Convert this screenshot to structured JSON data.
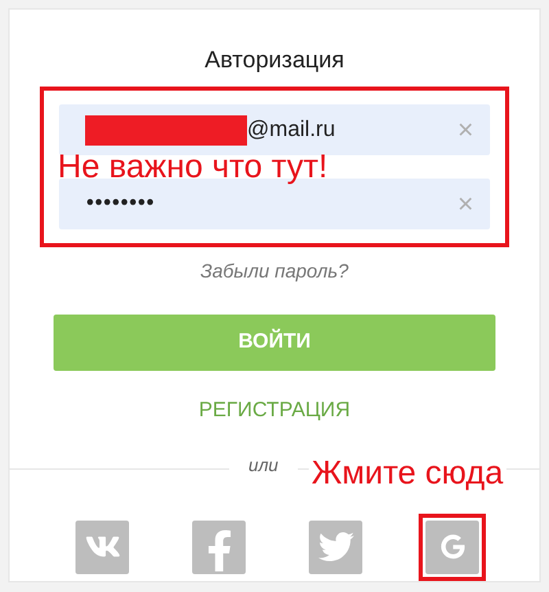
{
  "title": "Авторизация",
  "login_fields": [
    {
      "kind": "email",
      "value": "@mail.ru",
      "redacted": true,
      "clear": "×"
    },
    {
      "kind": "password",
      "value": "••••••••",
      "redacted": false,
      "clear": "×"
    }
  ],
  "fields_annotation": {
    "text": "Не важно что тут!",
    "highlighted": true
  },
  "forgot_link": "Забыли пароль?",
  "login_button": "ВОЙТИ",
  "register_link": "РЕГИСТРАЦИЯ",
  "divider_text": "или",
  "social_annotation": "Жмите сюда",
  "social_buttons": [
    {
      "kind": "vk",
      "highlighted": false
    },
    {
      "kind": "facebook",
      "highlighted": false
    },
    {
      "kind": "twitter",
      "highlighted": false
    },
    {
      "kind": "google",
      "highlighted": true
    }
  ]
}
